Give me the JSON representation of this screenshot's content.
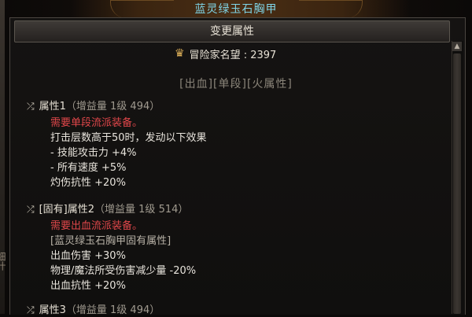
{
  "item_name": "蓝灵绿玉石胸甲",
  "header_button": "变更属性",
  "reputation": {
    "label": "冒险家名望",
    "separator": " : ",
    "value": "2397"
  },
  "tags": "[出血][单段][火属性]",
  "edge_text": "细什",
  "attributes": [
    {
      "title": "属性1",
      "meta": "（增益量 1级 494）",
      "lines": [
        {
          "text": "需要单段流派装备。",
          "style": "red"
        },
        {
          "text": "打击层数高于50时，发动以下效果",
          "style": "white"
        },
        {
          "text": "- 技能攻击力 +4%",
          "style": "white"
        },
        {
          "text": "- 所有速度 +5%",
          "style": "white"
        },
        {
          "text": "灼伤抗性 +20%",
          "style": "white"
        }
      ]
    },
    {
      "title": "[固有]属性2",
      "meta": "（增益量 1级 514）",
      "lines": [
        {
          "text": "需要出血流派装备。",
          "style": "red"
        },
        {
          "text": "[蓝灵绿玉石胸甲固有属性]",
          "style": "gray"
        },
        {
          "text": "出血伤害 +30%",
          "style": "white"
        },
        {
          "text": "物理/魔法所受伤害减少量 -20%",
          "style": "white"
        },
        {
          "text": "出血抗性 +20%",
          "style": "white"
        }
      ]
    },
    {
      "title": "属性3",
      "meta": "（增益量 1级 494）",
      "lines": []
    }
  ],
  "icons": {
    "shuffle": "shuffle-icon",
    "reputation": "reputation-emblem-icon",
    "scroll_up": "scroll-up-arrow-icon"
  }
}
